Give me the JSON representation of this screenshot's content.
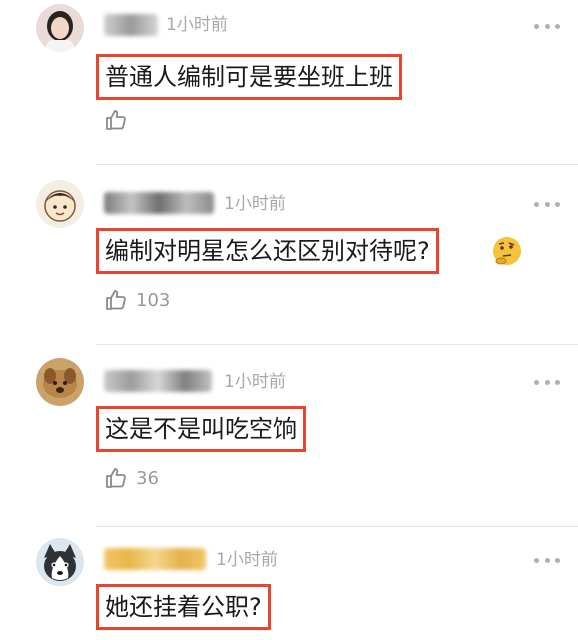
{
  "comments": [
    {
      "time": "1小时前",
      "text": "普通人编制可是要坐班上班",
      "likes": "",
      "avatar_icon": "avatar-woman-icon"
    },
    {
      "time": "1小时前",
      "text": "编制对明星怎么还区别对待呢?",
      "likes": "103",
      "avatar_icon": "avatar-cartoon-icon",
      "emoji": "thinking-face-icon"
    },
    {
      "time": "1小时前",
      "text": "这是不是叫吃空饷",
      "likes": "36",
      "avatar_icon": "avatar-dog-icon"
    },
    {
      "time": "1小时前",
      "text": "她还挂着公职?",
      "likes": "",
      "avatar_icon": "avatar-husky-icon"
    }
  ],
  "colors": {
    "highlight_border": "#e8452f",
    "meta_text": "#a8a8a8",
    "divider": "#e6e6e6"
  }
}
